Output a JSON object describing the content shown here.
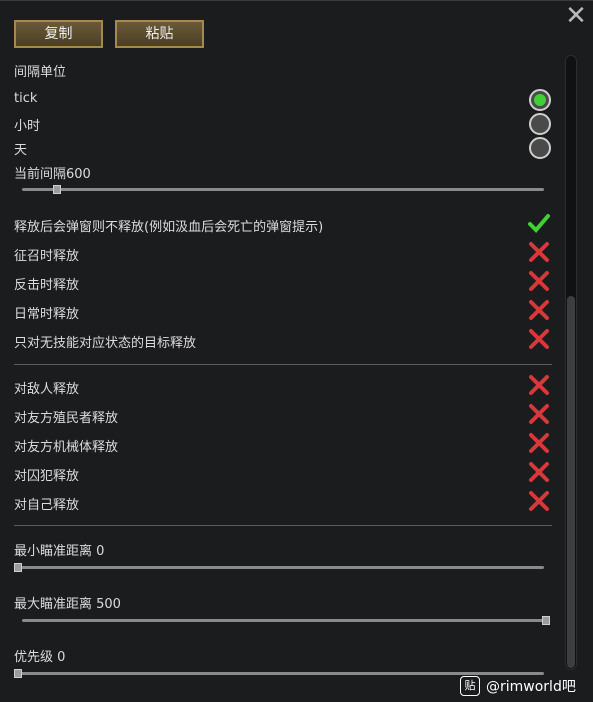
{
  "toolbar": {
    "copy_label": "复制",
    "paste_label": "粘贴"
  },
  "interval": {
    "section_title": "间隔单位",
    "options": [
      {
        "label": "tick",
        "selected": true
      },
      {
        "label": "小时",
        "selected": false
      },
      {
        "label": "天",
        "selected": false
      }
    ],
    "current_label": "当前间隔600",
    "slider_fraction": 0.06
  },
  "toggles_a": [
    {
      "label": "释放后会弹窗则不释放(例如汲血后会死亡的弹窗提示)",
      "checked": true
    },
    {
      "label": "征召时释放",
      "checked": false
    },
    {
      "label": "反击时释放",
      "checked": false
    },
    {
      "label": "日常时释放",
      "checked": false
    },
    {
      "label": "只对无技能对应状态的目标释放",
      "checked": false
    }
  ],
  "toggles_b": [
    {
      "label": "对敌人释放",
      "checked": false
    },
    {
      "label": "对友方殖民者释放",
      "checked": false
    },
    {
      "label": "对友方机械体释放",
      "checked": false
    },
    {
      "label": "对囚犯释放",
      "checked": false
    },
    {
      "label": "对自己释放",
      "checked": false
    }
  ],
  "min_distance": {
    "label": "最小瞄准距离 0",
    "slider_fraction": 0.0
  },
  "max_distance": {
    "label": "最大瞄准距离 500",
    "slider_fraction": 1.0
  },
  "priority": {
    "label": "优先级 0",
    "slider_fraction": 0.0
  },
  "watermark": {
    "icon_text": "贴",
    "text": "@rimworld吧"
  },
  "colors": {
    "check": "#3fd034",
    "cross": "#d9383a",
    "button_bg": "#5a4b2e",
    "button_border": "#a58a4f"
  }
}
